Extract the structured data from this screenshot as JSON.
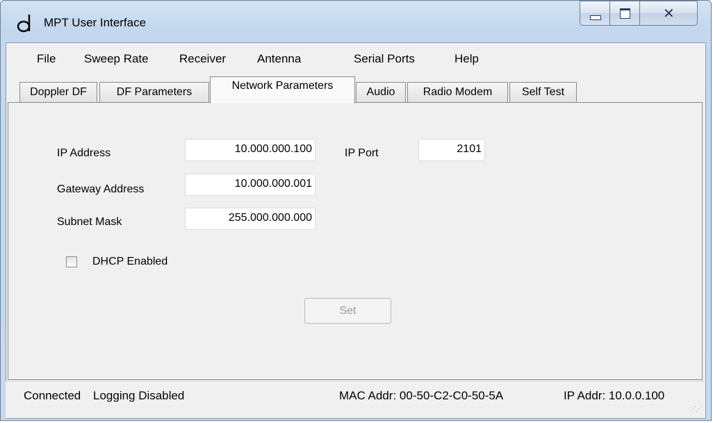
{
  "window": {
    "title": "MPT User Interface"
  },
  "menu": [
    "File",
    "Sweep Rate",
    "Receiver",
    "Antenna",
    "Serial Ports",
    "Help"
  ],
  "tabs": [
    "Doppler DF",
    "DF Parameters",
    "Network Parameters",
    "Audio",
    "Radio Modem",
    "Self Test"
  ],
  "active_tab": "Network Parameters",
  "network": {
    "ip_address_label": "IP Address",
    "ip_address": "10.000.000.100",
    "ip_port_label": "IP Port",
    "ip_port": "2101",
    "gateway_label": "Gateway Address",
    "gateway": "10.000.000.001",
    "subnet_label": "Subnet Mask",
    "subnet": "255.000.000.000",
    "dhcp_label": "DHCP Enabled",
    "dhcp_enabled": false,
    "set_label": "Set"
  },
  "status": {
    "connection": "Connected",
    "logging": "Logging Disabled",
    "mac": "MAC Addr: 00-50-C2-C0-50-5A",
    "ip": "IP Addr: 10.0.0.100"
  }
}
